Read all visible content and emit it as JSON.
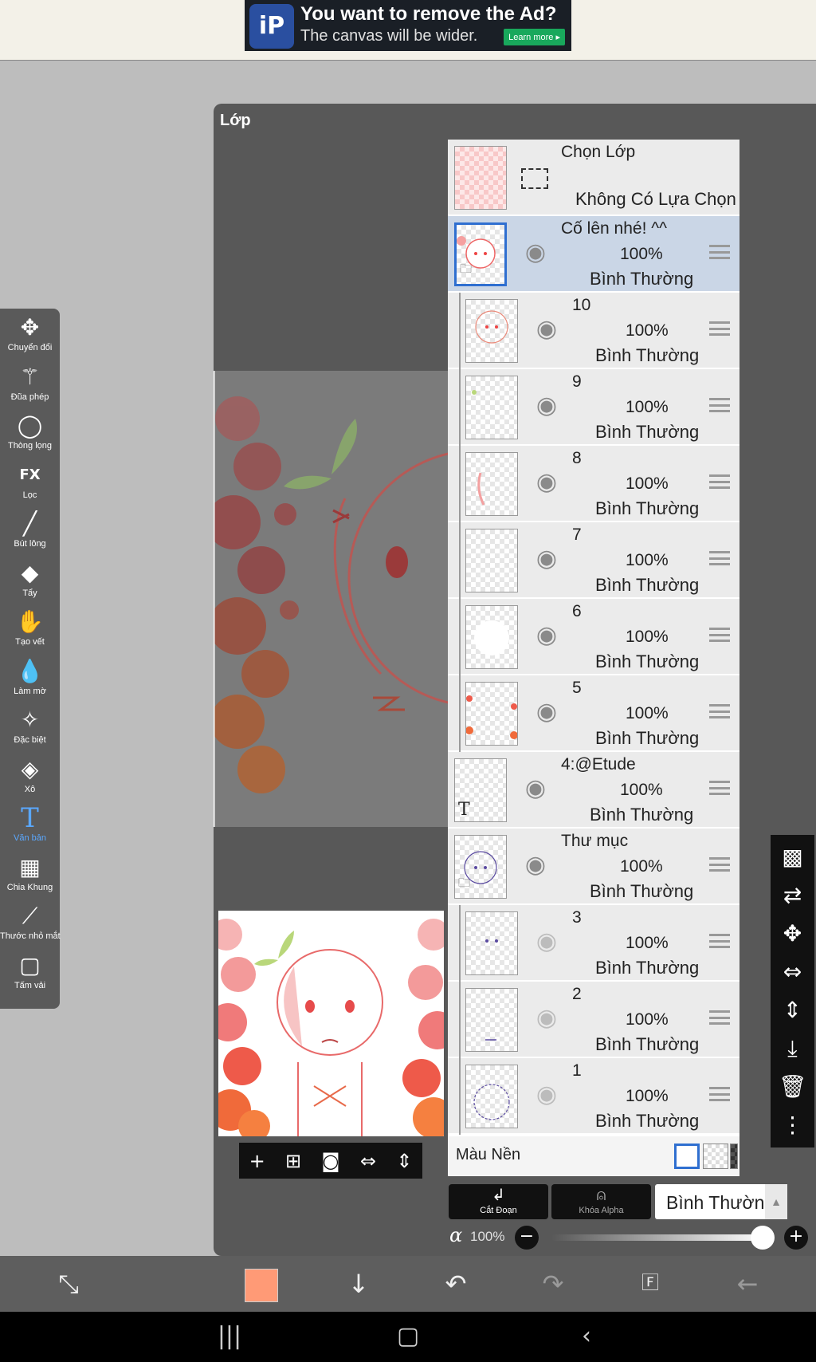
{
  "ad": {
    "logo_text": "iP",
    "title": "You want to remove the Ad?",
    "subtitle": "The canvas will be wider.",
    "button": "Learn more ▸"
  },
  "tools": [
    {
      "name": "transform",
      "icon": "move-icon",
      "glyph": "✥",
      "label": "Chuyển đổi"
    },
    {
      "name": "magic-wand",
      "icon": "magic-wand-icon",
      "glyph": "⚚",
      "label": "Đũa phép"
    },
    {
      "name": "lasso",
      "icon": "lasso-icon",
      "glyph": "◯",
      "label": "Thòng lọng"
    },
    {
      "name": "filter",
      "icon": "fx-icon",
      "glyph": "FX",
      "label": "Lọc"
    },
    {
      "name": "brush",
      "icon": "brush-icon",
      "glyph": "╱",
      "label": "Bút lông"
    },
    {
      "name": "eraser",
      "icon": "eraser-icon",
      "glyph": "◆",
      "label": "Tẩy"
    },
    {
      "name": "smudge",
      "icon": "smudge-icon",
      "glyph": "✋",
      "label": "Tạo vết"
    },
    {
      "name": "blur",
      "icon": "drop-icon",
      "glyph": "💧",
      "label": "Làm mờ"
    },
    {
      "name": "special",
      "icon": "special-brush-icon",
      "glyph": "✧",
      "label": "Đặc biệt"
    },
    {
      "name": "fill",
      "icon": "bucket-icon",
      "glyph": "◈",
      "label": "Xô"
    },
    {
      "name": "text",
      "icon": "text-icon",
      "glyph": "T",
      "label": "Văn bản",
      "active": true
    },
    {
      "name": "frame-divider",
      "icon": "frame-divider-icon",
      "glyph": "▦",
      "label": "Chia Khung"
    },
    {
      "name": "eyedropper",
      "icon": "eyedropper-icon",
      "glyph": "⟋",
      "label": "Thước nhỏ mắt"
    },
    {
      "name": "canvas",
      "icon": "canvas-icon",
      "glyph": "▢",
      "label": "Tấm vải"
    }
  ],
  "panel": {
    "title": "Lớp",
    "selection_row": {
      "name": "Chọn Lớp",
      "status": "Không Có Lựa Chọn"
    },
    "layers": [
      {
        "name": "Cố lên nhé! ^^",
        "opacity": "100%",
        "mode": "Bình Thường",
        "visible": true,
        "selected": true,
        "folder": true,
        "child": false
      },
      {
        "name": "10",
        "opacity": "100%",
        "mode": "Bình Thường",
        "visible": true,
        "child": true
      },
      {
        "name": "9",
        "opacity": "100%",
        "mode": "Bình Thường",
        "visible": true,
        "child": true
      },
      {
        "name": "8",
        "opacity": "100%",
        "mode": "Bình Thường",
        "visible": true,
        "child": true
      },
      {
        "name": "7",
        "opacity": "100%",
        "mode": "Bình Thường",
        "visible": true,
        "child": true
      },
      {
        "name": "6",
        "opacity": "100%",
        "mode": "Bình Thường",
        "visible": true,
        "child": true
      },
      {
        "name": "5",
        "opacity": "100%",
        "mode": "Bình Thường",
        "visible": true,
        "child": true
      },
      {
        "name": "4:@Etude",
        "opacity": "100%",
        "mode": "Bình Thường",
        "visible": true,
        "text": true,
        "child": false
      },
      {
        "name": "Thư mục",
        "opacity": "100%",
        "mode": "Bình Thường",
        "visible": true,
        "folder": true,
        "child": false
      },
      {
        "name": "3",
        "opacity": "100%",
        "mode": "Bình Thường",
        "visible": false,
        "child": true
      },
      {
        "name": "2",
        "opacity": "100%",
        "mode": "Bình Thường",
        "visible": false,
        "child": true
      },
      {
        "name": "1",
        "opacity": "100%",
        "mode": "Bình Thường",
        "visible": false,
        "child": true
      }
    ],
    "background_label": "Màu Nền",
    "clip_label": "Cắt Đoạn",
    "alpha_lock_label": "Khóa Alpha",
    "blend_mode": "Bình Thường",
    "alpha_symbol": "α",
    "alpha_value": "100%"
  },
  "right_tools": [
    "checker-icon",
    "layer-transfer-icon",
    "move-icon",
    "flip-horizontal-icon",
    "flip-vertical-icon",
    "merge-down-icon",
    "trash-icon",
    "more-icon"
  ],
  "colors": {
    "current_color": "#ff9a76",
    "accent": "#2f6fd0",
    "panel_bg": "#585858"
  }
}
